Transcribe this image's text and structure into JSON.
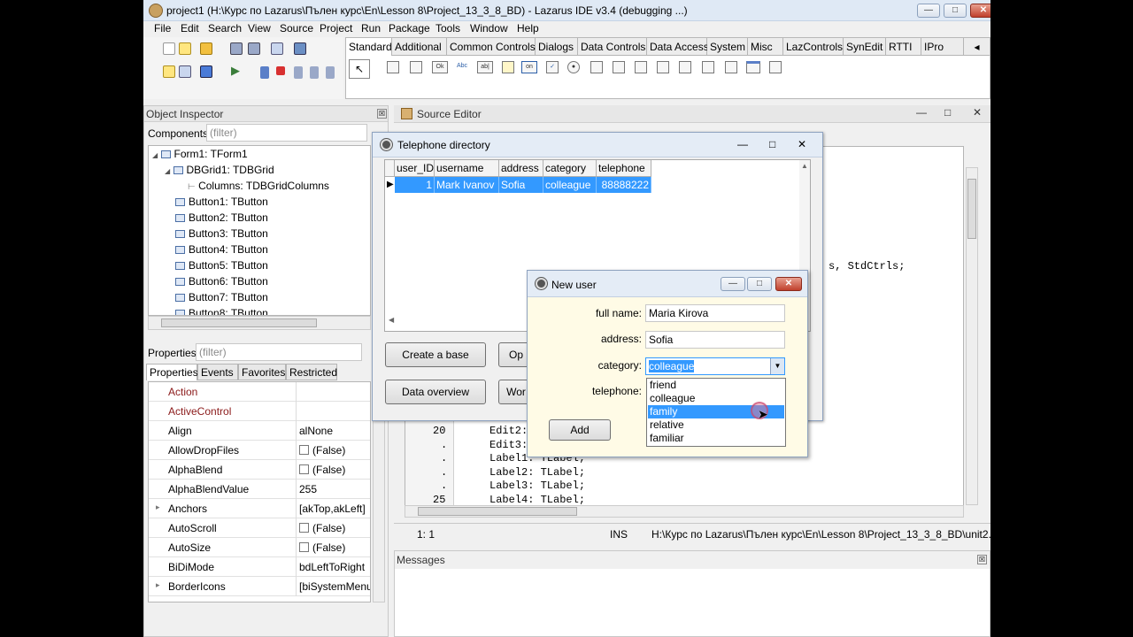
{
  "window": {
    "title": "project1 (H:\\Курс по Lazarus\\Пълен курс\\En\\Lesson 8\\Project_13_3_8_BD) - Lazarus IDE v3.4 (debugging ...)"
  },
  "menu": [
    "File",
    "Edit",
    "Search",
    "View",
    "Source",
    "Project",
    "Run",
    "Package",
    "Tools",
    "Window",
    "Help"
  ],
  "palette": {
    "tabs": [
      "Standard",
      "Additional",
      "Common Controls",
      "Dialogs",
      "Data Controls",
      "Data Access",
      "System",
      "Misc",
      "LazControls",
      "SynEdit",
      "RTTI",
      "IPro"
    ],
    "icons": [
      "",
      "",
      "Ok",
      "Abc",
      "ab|",
      "",
      "on",
      "",
      "",
      "",
      "",
      "",
      "",
      "",
      "",
      "",
      ""
    ]
  },
  "object_inspector": {
    "title": "Object Inspector",
    "components_label": "Components",
    "filter_placeholder": "(filter)",
    "tree": [
      {
        "text": "Form1: TForm1",
        "indent": 0
      },
      {
        "text": "DBGrid1: TDBGrid",
        "indent": 1
      },
      {
        "text": "Columns: TDBGridColumns",
        "indent": 2
      },
      {
        "text": "Button1: TButton",
        "indent": 1
      },
      {
        "text": "Button2: TButton",
        "indent": 1
      },
      {
        "text": "Button3: TButton",
        "indent": 1
      },
      {
        "text": "Button4: TButton",
        "indent": 1
      },
      {
        "text": "Button5: TButton",
        "indent": 1
      },
      {
        "text": "Button6: TButton",
        "indent": 1
      },
      {
        "text": "Button7: TButton",
        "indent": 1
      },
      {
        "text": "Button8: TButton",
        "indent": 1
      }
    ],
    "properties_label": "Properties",
    "tabs": [
      "Properties",
      "Events",
      "Favorites",
      "Restricted"
    ],
    "properties": [
      {
        "name": "Action",
        "value": "",
        "highlight": true,
        "checkbox": false
      },
      {
        "name": "ActiveControl",
        "value": "",
        "highlight": true,
        "checkbox": false
      },
      {
        "name": "Align",
        "value": "alNone",
        "highlight": false,
        "checkbox": false
      },
      {
        "name": "AllowDropFiles",
        "value": "(False)",
        "highlight": false,
        "checkbox": true
      },
      {
        "name": "AlphaBlend",
        "value": "(False)",
        "highlight": false,
        "checkbox": true
      },
      {
        "name": "AlphaBlendValue",
        "value": "255",
        "highlight": false,
        "checkbox": false
      },
      {
        "name": "Anchors",
        "value": "[akTop,akLeft]",
        "highlight": false,
        "checkbox": false,
        "expand": true
      },
      {
        "name": "AutoScroll",
        "value": "(False)",
        "highlight": false,
        "checkbox": true
      },
      {
        "name": "AutoSize",
        "value": "(False)",
        "highlight": false,
        "checkbox": true
      },
      {
        "name": "BiDiMode",
        "value": "bdLeftToRight",
        "highlight": false,
        "checkbox": false
      },
      {
        "name": "BorderIcons",
        "value": "[biSystemMenu,b",
        "highlight": false,
        "checkbox": false,
        "expand": true
      }
    ]
  },
  "source_editor": {
    "title": "Source Editor",
    "partial_line": "s, StdCtrls;",
    "gutter": [
      "20",
      ".",
      ".",
      ".",
      ".",
      "25"
    ],
    "lines": [
      "Edit2:",
      "Edit3:",
      "Label1: TLabel;",
      "Label2: TLabel;",
      "Label3: TLabel;",
      "Label4: TLabel;"
    ],
    "status": {
      "pos": "1:  1",
      "mode": "INS",
      "file": "H:\\Курс по Lazarus\\Пълен курс\\En\\Lesson 8\\Project_13_3_8_BD\\unit2.pas"
    }
  },
  "messages": {
    "title": "Messages"
  },
  "telephone_window": {
    "title": "Telephone directory",
    "columns": [
      "user_ID",
      "username",
      "address",
      "category",
      "telephone"
    ],
    "row": [
      "1",
      "Mark Ivanov",
      "Sofia",
      "colleague",
      "88888222"
    ],
    "buttons": [
      "Create a base",
      "Op",
      "Data overview",
      "Wor"
    ]
  },
  "new_user_dialog": {
    "title": "New user",
    "labels": {
      "fullname": "full name:",
      "address": "address:",
      "category": "category:",
      "telephone": "telephone:"
    },
    "values": {
      "fullname": "Maria Kirova",
      "address": "Sofia",
      "category": "colleague"
    },
    "options": [
      "friend",
      "colleague",
      "family",
      "relative",
      "familiar"
    ],
    "selected_option": "family",
    "add_button": "Add"
  },
  "colors": {
    "selection": "#3399ff",
    "property_highlight": "#8b1a1a"
  }
}
